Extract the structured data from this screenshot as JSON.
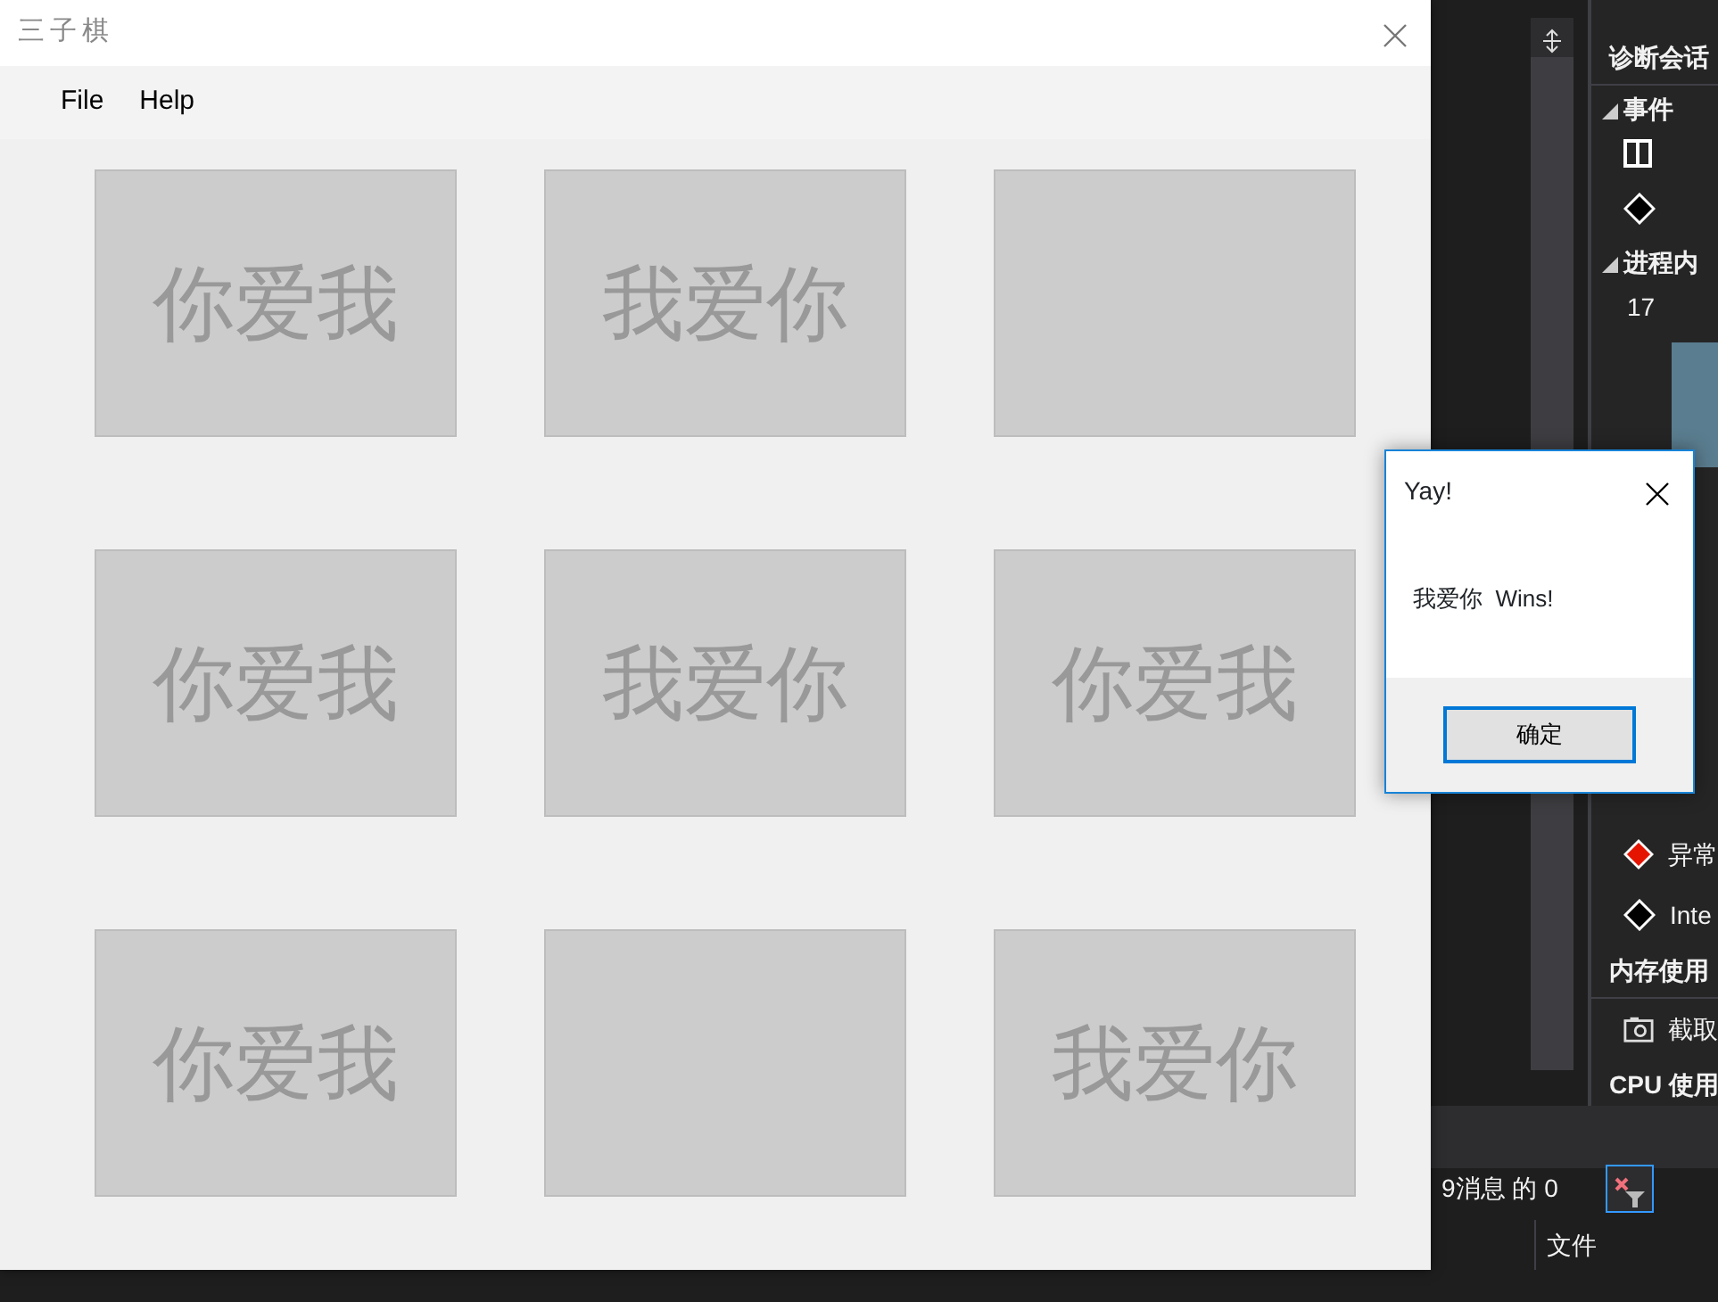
{
  "main_window": {
    "title": "三子棋",
    "menu": [
      "File",
      "Help"
    ],
    "board": [
      [
        {
          "kind": "mark",
          "label": "你爱我"
        },
        {
          "kind": "mark",
          "label": "我爱你"
        },
        {
          "kind": "empty"
        }
      ],
      [
        {
          "kind": "mark",
          "label": "你爱我"
        },
        {
          "kind": "mark",
          "label": "我爱你"
        },
        {
          "kind": "mark",
          "label": "你爱我"
        }
      ],
      [
        {
          "kind": "mark",
          "label": "你爱我"
        },
        {
          "kind": "empty"
        },
        {
          "kind": "mark",
          "label": "我爱你"
        }
      ]
    ]
  },
  "dialog": {
    "title": "Yay!",
    "message": "我爱你  Wins!",
    "button": "确定"
  },
  "ide_panel": {
    "top_items": [
      {
        "kind": "header",
        "text": "诊断会话"
      },
      {
        "kind": "section",
        "text": "事件"
      },
      {
        "kind": "columns"
      },
      {
        "kind": "marker"
      },
      {
        "kind": "section",
        "text": "进程内"
      },
      {
        "kind": "value",
        "text": "17"
      }
    ],
    "bottom_items": [
      {
        "kind": "alert",
        "text": "异常"
      },
      {
        "kind": "event",
        "text": "Inte"
      },
      {
        "kind": "header",
        "text": "内存使用"
      },
      {
        "kind": "snapshot",
        "text": "截取"
      },
      {
        "kind": "header",
        "text": "CPU 使用"
      }
    ]
  },
  "output_bar": {
    "message_count": "9消息 的 0",
    "column_header": "文件"
  }
}
